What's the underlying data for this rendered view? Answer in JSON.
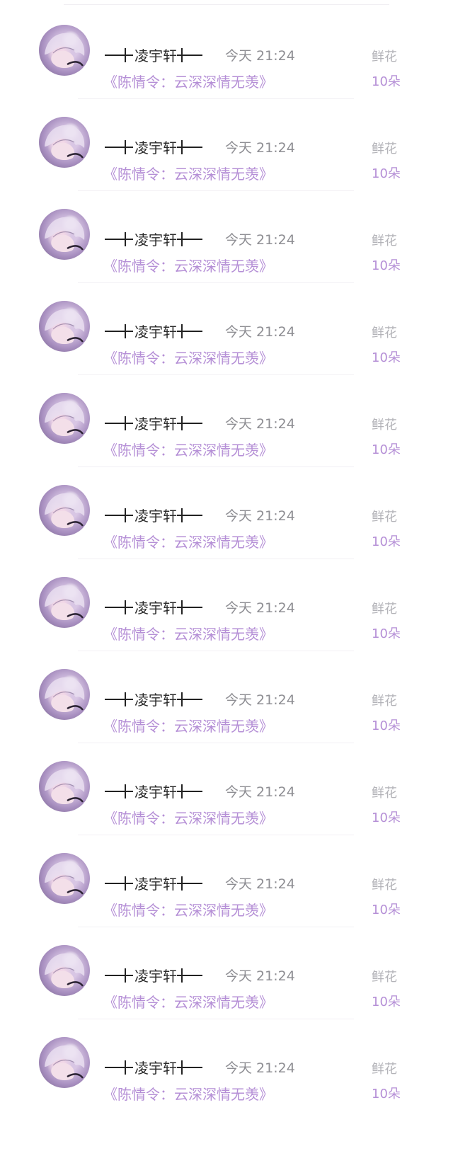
{
  "colors": {
    "username": "#2b2b2b",
    "time": "#8e8e93",
    "book_title": "#b58fd6",
    "gift_label": "#b3b3b8",
    "gift_count": "#b58fd6"
  },
  "list": [
    {
      "username": "凌宇轩",
      "time": "今天 21:24",
      "book": "《陈情令：云深深情无羡》",
      "gift_label": "鲜花",
      "gift_count": "10朵",
      "avatar_icon": "anime-avatar-icon"
    },
    {
      "username": "凌宇轩",
      "time": "今天 21:24",
      "book": "《陈情令：云深深情无羡》",
      "gift_label": "鲜花",
      "gift_count": "10朵",
      "avatar_icon": "anime-avatar-icon"
    },
    {
      "username": "凌宇轩",
      "time": "今天 21:24",
      "book": "《陈情令：云深深情无羡》",
      "gift_label": "鲜花",
      "gift_count": "10朵",
      "avatar_icon": "anime-avatar-icon"
    },
    {
      "username": "凌宇轩",
      "time": "今天 21:24",
      "book": "《陈情令：云深深情无羡》",
      "gift_label": "鲜花",
      "gift_count": "10朵",
      "avatar_icon": "anime-avatar-icon"
    },
    {
      "username": "凌宇轩",
      "time": "今天 21:24",
      "book": "《陈情令：云深深情无羡》",
      "gift_label": "鲜花",
      "gift_count": "10朵",
      "avatar_icon": "anime-avatar-icon"
    },
    {
      "username": "凌宇轩",
      "time": "今天 21:24",
      "book": "《陈情令：云深深情无羡》",
      "gift_label": "鲜花",
      "gift_count": "10朵",
      "avatar_icon": "anime-avatar-icon"
    },
    {
      "username": "凌宇轩",
      "time": "今天 21:24",
      "book": "《陈情令：云深深情无羡》",
      "gift_label": "鲜花",
      "gift_count": "10朵",
      "avatar_icon": "anime-avatar-icon"
    },
    {
      "username": "凌宇轩",
      "time": "今天 21:24",
      "book": "《陈情令：云深深情无羡》",
      "gift_label": "鲜花",
      "gift_count": "10朵",
      "avatar_icon": "anime-avatar-icon"
    },
    {
      "username": "凌宇轩",
      "time": "今天 21:24",
      "book": "《陈情令：云深深情无羡》",
      "gift_label": "鲜花",
      "gift_count": "10朵",
      "avatar_icon": "anime-avatar-icon"
    },
    {
      "username": "凌宇轩",
      "time": "今天 21:24",
      "book": "《陈情令：云深深情无羡》",
      "gift_label": "鲜花",
      "gift_count": "10朵",
      "avatar_icon": "anime-avatar-icon"
    },
    {
      "username": "凌宇轩",
      "time": "今天 21:24",
      "book": "《陈情令：云深深情无羡》",
      "gift_label": "鲜花",
      "gift_count": "10朵",
      "avatar_icon": "anime-avatar-icon"
    },
    {
      "username": "凌宇轩",
      "time": "今天 21:24",
      "book": "《陈情令：云深深情无羡》",
      "gift_label": "鲜花",
      "gift_count": "10朵",
      "avatar_icon": "anime-avatar-icon"
    }
  ]
}
